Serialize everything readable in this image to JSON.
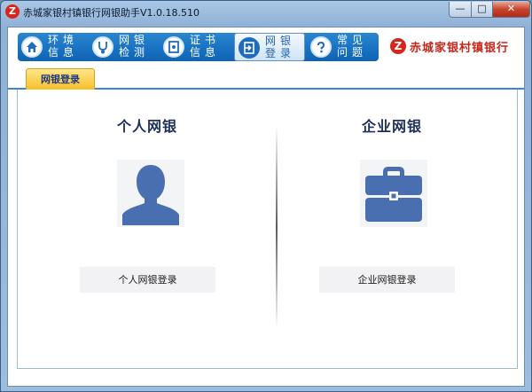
{
  "window": {
    "title": "赤城家银村镇银行网银助手V1.0.18.510",
    "min_label": "—",
    "max_label": "□",
    "close_label": "✕",
    "app_icon_char": "Z"
  },
  "nav": {
    "items": [
      {
        "label": "环境\n信息",
        "icon": "home-icon"
      },
      {
        "label": "网银\n检测",
        "icon": "stethoscope-icon"
      },
      {
        "label": "证书\n信息",
        "icon": "certificate-icon"
      },
      {
        "label": "网银\n登录",
        "icon": "login-icon",
        "active": true
      },
      {
        "label": "常见\n问题",
        "icon": "question-icon"
      }
    ]
  },
  "brand": {
    "logo_char": "Z",
    "name": "赤城家银村镇银行"
  },
  "tab": {
    "label": "网银登录"
  },
  "personal": {
    "title": "个人网银",
    "button": "个人网银登录",
    "icon": "person-icon"
  },
  "corporate": {
    "title": "企业网银",
    "button": "企业网银登录",
    "icon": "briefcase-icon"
  },
  "colors": {
    "accent": "#1f6cbc",
    "icon_blue": "#4a6fb0",
    "tab_yellow": "#f6c02a",
    "brand_red": "#c8261b"
  }
}
